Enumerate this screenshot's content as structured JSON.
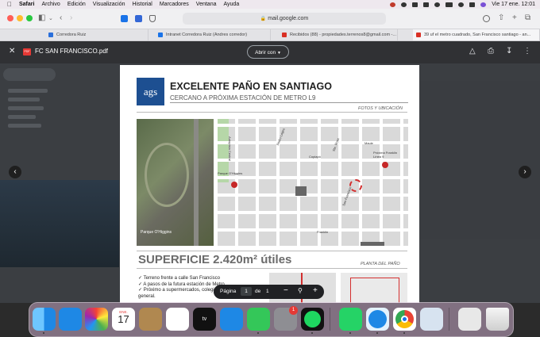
{
  "menubar": {
    "apple": "",
    "items": [
      "Safari",
      "Archivo",
      "Edición",
      "Visualización",
      "Historial",
      "Marcadores",
      "Ventana",
      "Ayuda"
    ],
    "datetime": "Vie 17 ene.  12:01"
  },
  "toolbar": {
    "url": "mail.google.com"
  },
  "tabs": [
    {
      "label": "Corredora Ruiz",
      "color": "#2a6fdb"
    },
    {
      "label": "Intranet Corredora Ruiz (Andres corredor)",
      "color": "#1a73e8"
    },
    {
      "label": "Recibidos (88) - propiedades.terrenos8@gmail.com -...",
      "color": "#d93025"
    },
    {
      "label": "39 uf el metro cuadrado, San Francisco santiago - an...",
      "color": "#d93025"
    }
  ],
  "viewer": {
    "filename": "FC SAN FRANCISCO.pdf",
    "pdf_badge": "PDF",
    "open_with": "Abrir con"
  },
  "pdf": {
    "logo": "ags",
    "headline": "EXCELENTE PAÑO EN SANTIAGO",
    "subheadline": "CERCANO A PRÓXIMA ESTACIÓN DE METRO L9",
    "section1": "FOTOS Y UBICACIÓN",
    "aerial_caption": "Parque O'Higgins",
    "map_labels": [
      "Pedro Lagos",
      "Autopista Central",
      "Parque O'Higgins",
      "Sta. Rosa",
      "Copiapó",
      "San Francisco",
      "Porvenir",
      "Carlos Silva Vildósola",
      "Lira",
      "Maule",
      "Franklin"
    ],
    "metro_label": "Próxima Franklin Línea 9",
    "surface": "SUPERFICIE 2.420m² útiles",
    "section2": "PLANTA DEL PAÑO",
    "bullets": [
      "Terreno frente a calle San Francisco",
      "A pasos de la futura estación de Metro",
      "Próximo a supermercados, colegios y servicios en general."
    ]
  },
  "pager": {
    "label": "Página",
    "current": "1",
    "sep": "de",
    "total": "1"
  },
  "dock": {
    "calendar_month": "ENE.",
    "calendar_day": "17",
    "badge": "1",
    "apps": [
      "Finder",
      "Mail",
      "Photos",
      "Calendar",
      "Contacts",
      "Reminders",
      "TV",
      "App Store",
      "Messages",
      "System Settings",
      "Spotify",
      "WhatsApp",
      "Safari",
      "Chrome",
      "Preview",
      "Downloads",
      "Trash"
    ]
  }
}
